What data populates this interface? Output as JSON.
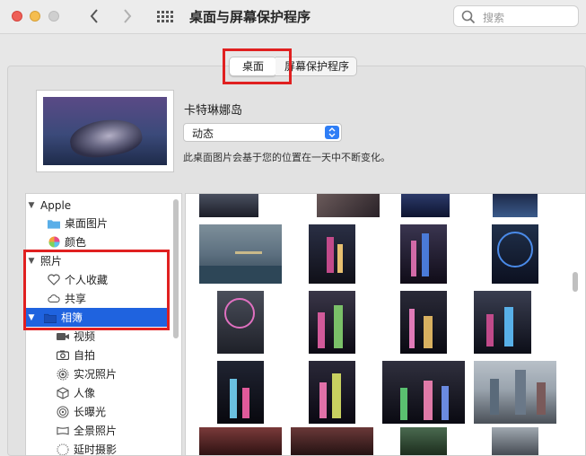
{
  "window": {
    "title": "桌面与屏幕保护程序",
    "search_placeholder": "搜索"
  },
  "tabs": [
    {
      "label": "桌面",
      "active": true
    },
    {
      "label": "屏幕保护程序",
      "active": false
    }
  ],
  "wallpaper": {
    "name": "卡特琳娜岛",
    "mode": "动态",
    "description": "此桌面图片会基于您的位置在一天中不断变化。"
  },
  "sidebar": {
    "groups": [
      {
        "label": "Apple",
        "items": [
          {
            "label": "桌面图片",
            "icon": "folder-icon"
          },
          {
            "label": "颜色",
            "icon": "color-wheel-icon"
          }
        ]
      },
      {
        "label": "照片",
        "items": [
          {
            "label": "个人收藏",
            "icon": "heart-icon"
          },
          {
            "label": "共享",
            "icon": "cloud-icon"
          },
          {
            "label": "相簿",
            "icon": "folder-icon",
            "selected": true
          },
          {
            "label": "视频",
            "icon": "video-icon"
          },
          {
            "label": "自拍",
            "icon": "camera-icon"
          },
          {
            "label": "实况照片",
            "icon": "live-photo-icon"
          },
          {
            "label": "人像",
            "icon": "cube-icon"
          },
          {
            "label": "长曝光",
            "icon": "long-exposure-icon"
          },
          {
            "label": "全景照片",
            "icon": "panorama-icon"
          },
          {
            "label": "延时摄影",
            "icon": "timelapse-icon"
          }
        ]
      }
    ]
  },
  "colors": {
    "accent": "#1f63df",
    "highlight": "#e02020"
  }
}
